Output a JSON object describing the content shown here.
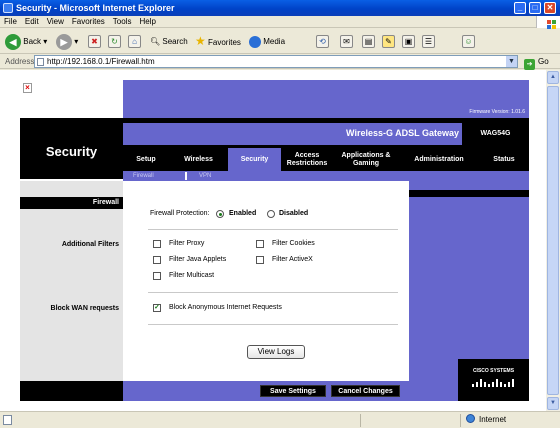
{
  "window": {
    "title": "Security - Microsoft Internet Explorer"
  },
  "menu": [
    "File",
    "Edit",
    "View",
    "Favorites",
    "Tools",
    "Help"
  ],
  "toolbar": {
    "back_label": "Back",
    "search_label": "Search",
    "favorites_label": "Favorites",
    "media_label": "Media"
  },
  "address": {
    "label": "Address",
    "url": "http://192.168.0.1/Firewall.htm",
    "go_label": "Go"
  },
  "router": {
    "firmware": "Firmware Version: 1.01.6",
    "product": "Wireless-G ADSL Gateway",
    "model": "WAG54G",
    "section_title": "Security",
    "tabs": [
      {
        "label": "Setup",
        "active": false
      },
      {
        "label": "Wireless",
        "active": false
      },
      {
        "label": "Security",
        "active": true
      },
      {
        "label": "Access Restrictions",
        "active": false
      },
      {
        "label": "Applications & Gaming",
        "active": false
      },
      {
        "label": "Administration",
        "active": false
      },
      {
        "label": "Status",
        "active": false
      }
    ],
    "subtabs": [
      "Firewall",
      "VPN"
    ],
    "left_heading": "Firewall",
    "labels": {
      "additional_filters": "Additional Filters",
      "block_wan": "Block WAN requests"
    },
    "firewall_protection": {
      "label": "Firewall Protection:",
      "enabled_label": "Enabled",
      "disabled_label": "Disabled",
      "value": "Enabled"
    },
    "filters": [
      {
        "label": "Filter Proxy",
        "checked": false
      },
      {
        "label": "Filter Cookies",
        "checked": false
      },
      {
        "label": "Filter Java Applets",
        "checked": false
      },
      {
        "label": "Filter ActiveX",
        "checked": false
      },
      {
        "label": "Filter Multicast",
        "checked": false
      }
    ],
    "block_anonymous": {
      "label": "Block Anonymous Internet Requests",
      "checked": true
    },
    "view_logs": "View Logs",
    "save": "Save Settings",
    "cancel": "Cancel Changes",
    "cisco": "Cisco Systems",
    "accent_color": "#6666cc"
  },
  "status": {
    "zone": "Internet"
  }
}
